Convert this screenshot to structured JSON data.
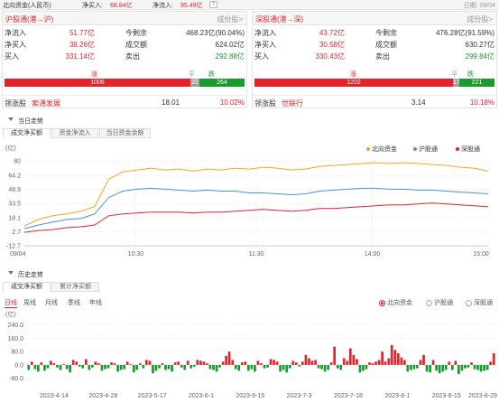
{
  "top": {
    "title": "北向资金(人民币)",
    "buy_label": "净买入:",
    "buy_value": "68.84亿",
    "inflow_label": "净流入:",
    "inflow_value": "95.49亿",
    "help": "?",
    "date": "日期: 09/04"
  },
  "sh": {
    "title": "沪股通(港→沪)",
    "link": "成份股>",
    "r1": {
      "l1": "净流入",
      "v1": "51.77亿",
      "l2": "今剩余",
      "v2": "468.23亿(90.04%)"
    },
    "r2": {
      "l1": "净买入",
      "v1": "38.26亿",
      "l2": "成交额",
      "v2": "624.02亿"
    },
    "r3": {
      "l1": "买入",
      "v1": "331.14亿",
      "l2": "卖出",
      "v2": "292.88亿"
    },
    "up_label": "涨",
    "flat_label": "平",
    "down_label": "跌",
    "up": 1006,
    "flat": 22,
    "down": 264,
    "lead_label": "领涨股",
    "lead_name": "索通发展",
    "lead_price": "18.01",
    "lead_pct": "10.02%"
  },
  "sz": {
    "title": "深股通(港→深)",
    "link": "成份股>",
    "r1": {
      "l1": "净流入",
      "v1": "43.72亿",
      "l2": "今剩余",
      "v2": "476.28亿(91.59%)"
    },
    "r2": {
      "l1": "净买入",
      "v1": "30.58亿",
      "l2": "成交额",
      "v2": "630.27亿"
    },
    "r3": {
      "l1": "买入",
      "v1": "330.43亿",
      "l2": "卖出",
      "v2": "299.84亿"
    },
    "up_label": "涨",
    "flat_label": "平",
    "down_label": "跌",
    "up": 1202,
    "flat": 17,
    "down": 221,
    "lead_label": "领涨股",
    "lead_name": "世联行",
    "lead_price": "3.14",
    "lead_pct": "10.18%"
  },
  "intraday": {
    "section": "当日走势",
    "tabs": [
      "成交净买额",
      "资金净流入",
      "当日资金余额"
    ],
    "unit": "(亿)",
    "legend": [
      "北向资金",
      "沪股通",
      "深股通"
    ],
    "colors": {
      "north": "#f5a623",
      "sh": "#4a90e2",
      "sz": "#e4242b"
    }
  },
  "history": {
    "section": "历史走势",
    "tabs": [
      "成交净买额",
      "累计净买额"
    ],
    "periods": [
      "日线",
      "周线",
      "月线",
      "季线",
      "年线"
    ],
    "radios": [
      "北向资金",
      "沪股通",
      "深股通"
    ],
    "unit": "(亿)"
  },
  "chart_data": [
    {
      "type": "line",
      "x_ticks": [
        "09/04",
        "10:30",
        "11:30",
        "14:00",
        "15:00"
      ],
      "y_ticks": [
        80.0,
        64.2,
        48.9,
        33.5,
        18.1,
        2.7,
        -12.7
      ],
      "ylim": [
        -12.7,
        80.0
      ],
      "legend": "top-right",
      "series": [
        {
          "name": "北向资金",
          "values": [
            9,
            16,
            20,
            22,
            25,
            30,
            60,
            68,
            70,
            72,
            70,
            71,
            69,
            71,
            70,
            72,
            71,
            73,
            72,
            70,
            71,
            74,
            75,
            76,
            77,
            78,
            77,
            78,
            77,
            76,
            75,
            73,
            72,
            69
          ]
        },
        {
          "name": "沪股通",
          "values": [
            6,
            10,
            13,
            16,
            17,
            22,
            40,
            47,
            49,
            50,
            49,
            48,
            47,
            48,
            47,
            47,
            45,
            45,
            44,
            43,
            44,
            47,
            48,
            49,
            50,
            50,
            49,
            49,
            48,
            48,
            47,
            46,
            45,
            44
          ]
        },
        {
          "name": "深股通",
          "values": [
            2,
            4,
            5,
            7,
            8,
            10,
            20,
            22,
            23,
            24,
            24,
            24,
            23,
            24,
            24,
            25,
            26,
            27,
            26,
            25,
            26,
            28,
            28,
            29,
            30,
            31,
            32,
            32,
            33,
            34,
            33,
            32,
            31,
            30
          ]
        }
      ]
    },
    {
      "type": "bar",
      "series_name": "北向资金",
      "x_ticks": [
        "2023-4-14",
        "2023-4-28",
        "2023-5-17",
        "2023-6-1",
        "2023-6-15",
        "2023-7-3",
        "2023-7-18",
        "2023-8-1",
        "2023-8-15",
        "2023-8-29"
      ],
      "y_ticks": [
        240.0,
        160.0,
        80.0,
        0.0,
        -80.0
      ],
      "ylim": [
        -120,
        260
      ],
      "values": [
        -30,
        20,
        -25,
        -40,
        15,
        -35,
        -20,
        25,
        10,
        -15,
        -30,
        5,
        -25,
        -45,
        30,
        20,
        -10,
        -20,
        35,
        -30,
        -15,
        20,
        10,
        -35,
        -25,
        -20,
        15,
        10,
        -40,
        -30,
        -25,
        20,
        5,
        -45,
        -30,
        10,
        -20,
        30,
        25,
        -50,
        -35,
        -20,
        10,
        -30,
        -25,
        -40,
        15,
        20,
        -15,
        -30,
        25,
        -20,
        -10,
        30,
        25,
        20,
        10,
        -25,
        -30,
        -40,
        -15,
        20,
        55,
        80,
        30,
        -25,
        -35,
        15,
        20,
        -35,
        -25,
        -40,
        25,
        10,
        -20,
        -15,
        35,
        30,
        20,
        -40,
        -30,
        -45,
        -20,
        25,
        15,
        -10,
        20,
        60,
        40,
        25,
        30,
        -20,
        -25,
        -40,
        -30,
        15,
        110,
        -20,
        -30,
        40,
        25,
        100,
        60,
        35,
        -45,
        -35,
        -25,
        15,
        10,
        20,
        30,
        80,
        20,
        40,
        120,
        90,
        70,
        45,
        30,
        -40,
        -30,
        -25,
        -20,
        30,
        60,
        -40,
        -45,
        30,
        -35,
        -50,
        -40,
        -30,
        20,
        -30,
        25,
        -55,
        -35,
        -20,
        -15,
        15,
        -25,
        -30,
        -40,
        -35,
        -30,
        20,
        70
      ]
    }
  ]
}
